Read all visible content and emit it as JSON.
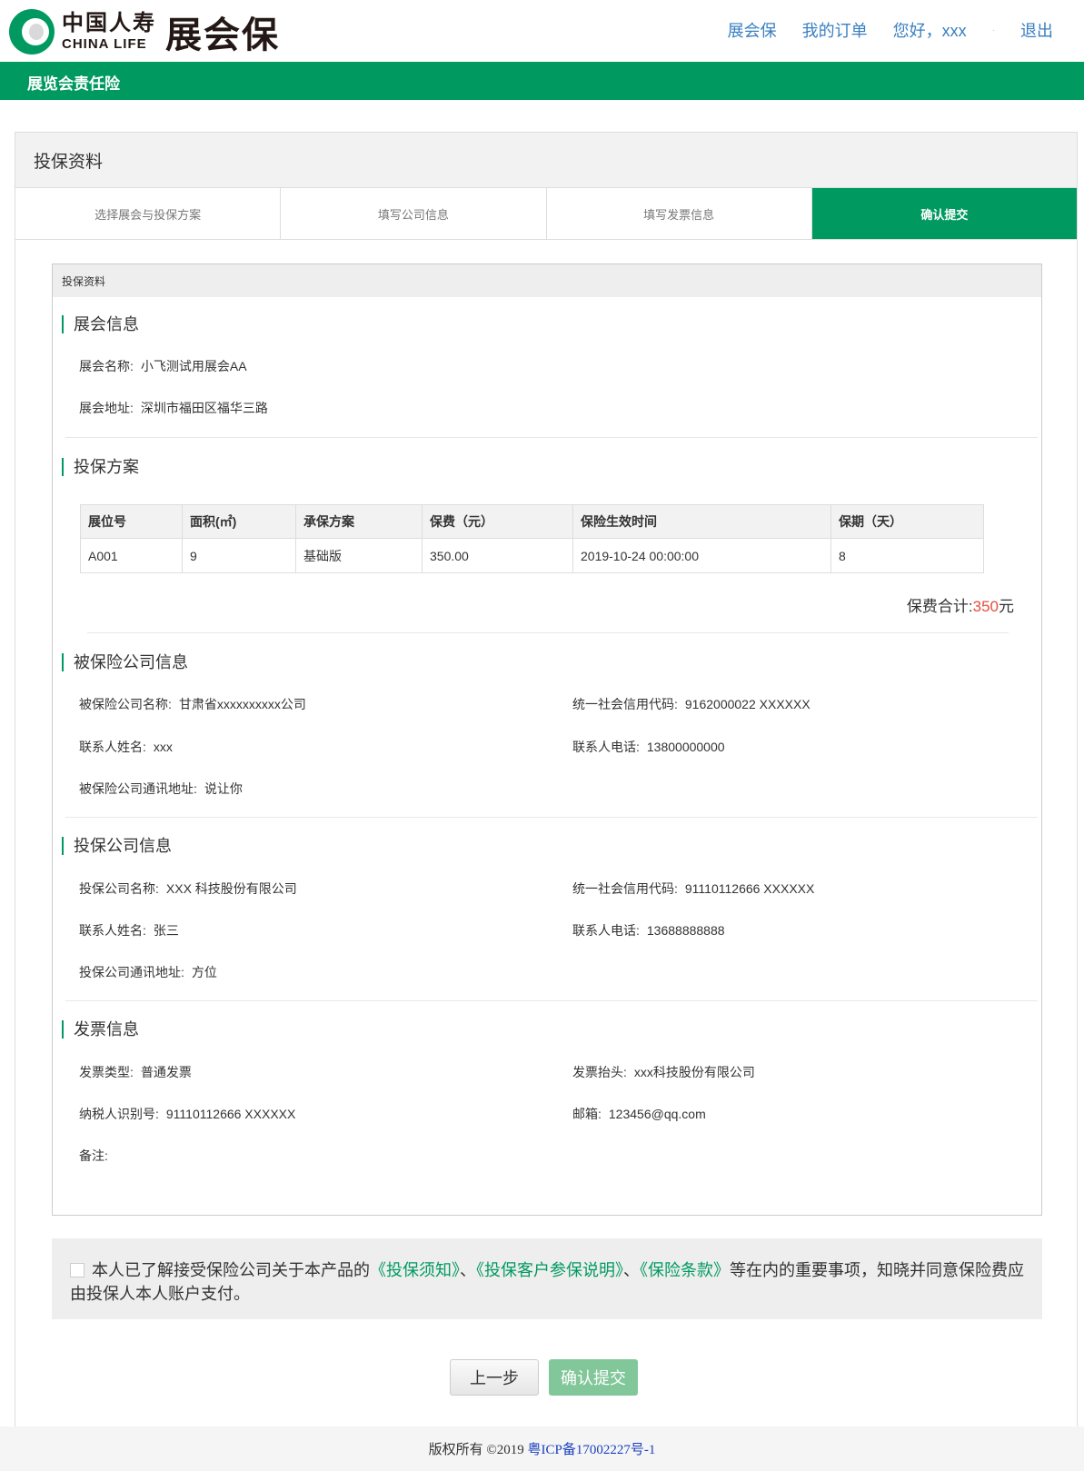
{
  "header": {
    "logo_cn": "中国人寿",
    "logo_en": "CHINA LIFE",
    "product": "展会保",
    "nav": {
      "home": "展会保",
      "orders": "我的订单",
      "greeting": "您好，xxx",
      "separator": "·",
      "logout": "退出"
    }
  },
  "banner": {
    "title": "展览会责任险"
  },
  "panel": {
    "title": "投保资料",
    "steps": [
      {
        "label": "选择展会与投保方案"
      },
      {
        "label": "填写公司信息"
      },
      {
        "label": "填写发票信息"
      },
      {
        "label": "确认提交"
      }
    ]
  },
  "info": {
    "title": "投保资料",
    "exhibition": {
      "title": "展会信息",
      "name_label": "展会名称:",
      "name": "小飞测试用展会AA",
      "address_label": "展会地址:",
      "address": "深圳市福田区福华三路"
    },
    "plan": {
      "title": "投保方案",
      "columns": [
        "展位号",
        "面积(㎡)",
        "承保方案",
        "保费（元）",
        "保险生效时间",
        "保期（天）"
      ],
      "rows": [
        [
          "A001",
          "9",
          "基础版",
          "350.00",
          "2019-10-24 00:00:00",
          "8"
        ]
      ],
      "total_label": "保费合计:",
      "total_amount": "350",
      "total_unit": "元"
    },
    "insured": {
      "title": "被保险公司信息",
      "name_label": "被保险公司名称:",
      "name": "甘肃省xxxxxxxxxx公司",
      "credit_label": "统一社会信用代码:",
      "credit": "9162000022 XXXXXX",
      "contact_label": "联系人姓名:",
      "contact": "xxx",
      "phone_label": "联系人电话:",
      "phone": "13800000000",
      "address_label": "被保险公司通讯地址:",
      "address": "说让你"
    },
    "applicant": {
      "title": "投保公司信息",
      "name_label": "投保公司名称:",
      "name": "XXX 科技股份有限公司",
      "credit_label": "统一社会信用代码:",
      "credit": "91110112666 XXXXXX",
      "contact_label": "联系人姓名:",
      "contact": "张三",
      "phone_label": "联系人电话:",
      "phone": "13688888888",
      "address_label": "投保公司通讯地址:",
      "address": "方位"
    },
    "invoice": {
      "title": "发票信息",
      "type_label": "发票类型:",
      "type": "普通发票",
      "header_label": "发票抬头:",
      "header": "xxx科技股份有限公司",
      "tax_label": "纳税人识别号:",
      "tax": "91110112666 XXXXXX",
      "email_label": "邮箱:",
      "email": "123456@qq.com",
      "remark_label": "备注:",
      "remark": ""
    }
  },
  "agreement": {
    "checked": false,
    "text_before": "本人已了解接受保险公司关于本产品的",
    "doc1": "《投保须知》",
    "sep1": "、",
    "doc2": "《投保客户参保说明》",
    "sep2": "、",
    "doc3": "《保险条款》",
    "text_after": "等在内的重要事项，知晓并同意保险费应由投保人本人账户支付。"
  },
  "buttons": {
    "prev": "上一步",
    "submit": "确认提交"
  },
  "footer": {
    "copyright": "版权所有 ©2019 ",
    "icp": "粤ICP备17002227号-1"
  },
  "colors": {
    "brand_green": "#009a61",
    "link_blue": "#3a7fc1",
    "amount_red": "#e74c3c",
    "submit_disabled": "#82c79a"
  }
}
